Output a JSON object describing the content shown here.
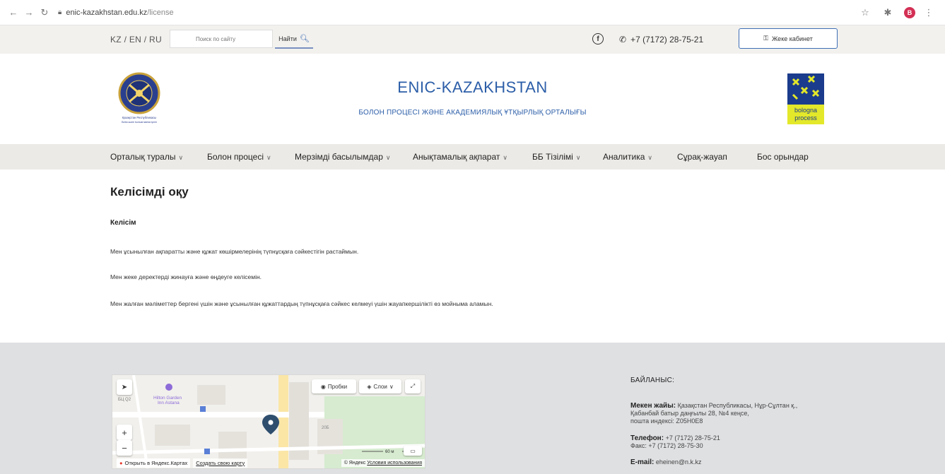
{
  "browser": {
    "url_host": "enic-kazakhstan.edu.kz",
    "url_path": "/license",
    "profile_initial": "B"
  },
  "topbar": {
    "languages": "KZ / EN / RU",
    "search_placeholder": "Поиск по сайту",
    "search_button": "Найти",
    "phone": "+7 (7172) 28-75-21",
    "cabinet_button": "Жеке кабинет"
  },
  "header": {
    "title": "ENIC-KAZAKHSTAN",
    "subtitle": "БОЛОН ПРОЦЕСІ ЖӘНЕ АКАДЕМИЯЛЫҚ ҰТҚЫРЛЫҚ ОРТАЛЫҒЫ",
    "emblem_caption_1": "Қазақстан Республикасы",
    "emblem_caption_2": "Білім және ғылым министрлігі",
    "bologna_line1": "bologna",
    "bologna_line2": "process"
  },
  "nav": {
    "items": [
      {
        "label": "Орталық туралы",
        "dropdown": true
      },
      {
        "label": "Болон процесі",
        "dropdown": true
      },
      {
        "label": "Мерзімді басылымдар",
        "dropdown": true
      },
      {
        "label": "Анықтамалық ақпарат",
        "dropdown": true
      },
      {
        "label": "ББ Тізілімі",
        "dropdown": true
      },
      {
        "label": "Аналитика",
        "dropdown": true
      },
      {
        "label": "Сұрақ-жауап",
        "dropdown": false
      },
      {
        "label": "Бос орындар",
        "dropdown": false
      }
    ]
  },
  "content": {
    "page_title": "Келісімді оқу",
    "section_heading": "Келісім",
    "paragraphs": [
      "Мен ұсынылған ақпаратты және құжат көшірмелерінің түпнұсқаға сәйкестігін растаймын.",
      "Мен жеке деректерді жинауға және өңдеуге келісемін.",
      "Мен жалған мәліметтер бергені үшін және ұсынылған құжаттардың түпнұсқаға сәйкес келмеуі үшін жауапкершілікті өз мойныма аламын."
    ]
  },
  "map": {
    "traffic_button": "Пробки",
    "layers_button": "Слои",
    "open_link": "Открыть в Яндекс.Картах",
    "create_link": "Создать свою карту",
    "copyright": "© Яндекс",
    "terms_link": "Условия использования",
    "scale": "60 м",
    "poi_label_1": "Hilton Garden",
    "poi_label_2": "Inn Astana",
    "building_label": "БЦ Q2",
    "number_label": "20Б"
  },
  "contacts": {
    "heading": "БАЙЛАНЫС:",
    "address_label": "Мекен жайы:",
    "address_text": "Қазақстан Республикасы, Нұр-Сұлтан қ.,",
    "address_text_2": "Қабанбай батыр даңғылы 28, №4 кеңсе,",
    "address_text_3": "пошта индексі: Z05H0E8",
    "phone_label": "Телефон:",
    "phone_text": "+7 (7172) 28-75-21",
    "fax_text": "Факс: +7 (7172) 28-75-30",
    "email_label": "E-mail:",
    "email_text": "eheinen@n.k.kz"
  }
}
